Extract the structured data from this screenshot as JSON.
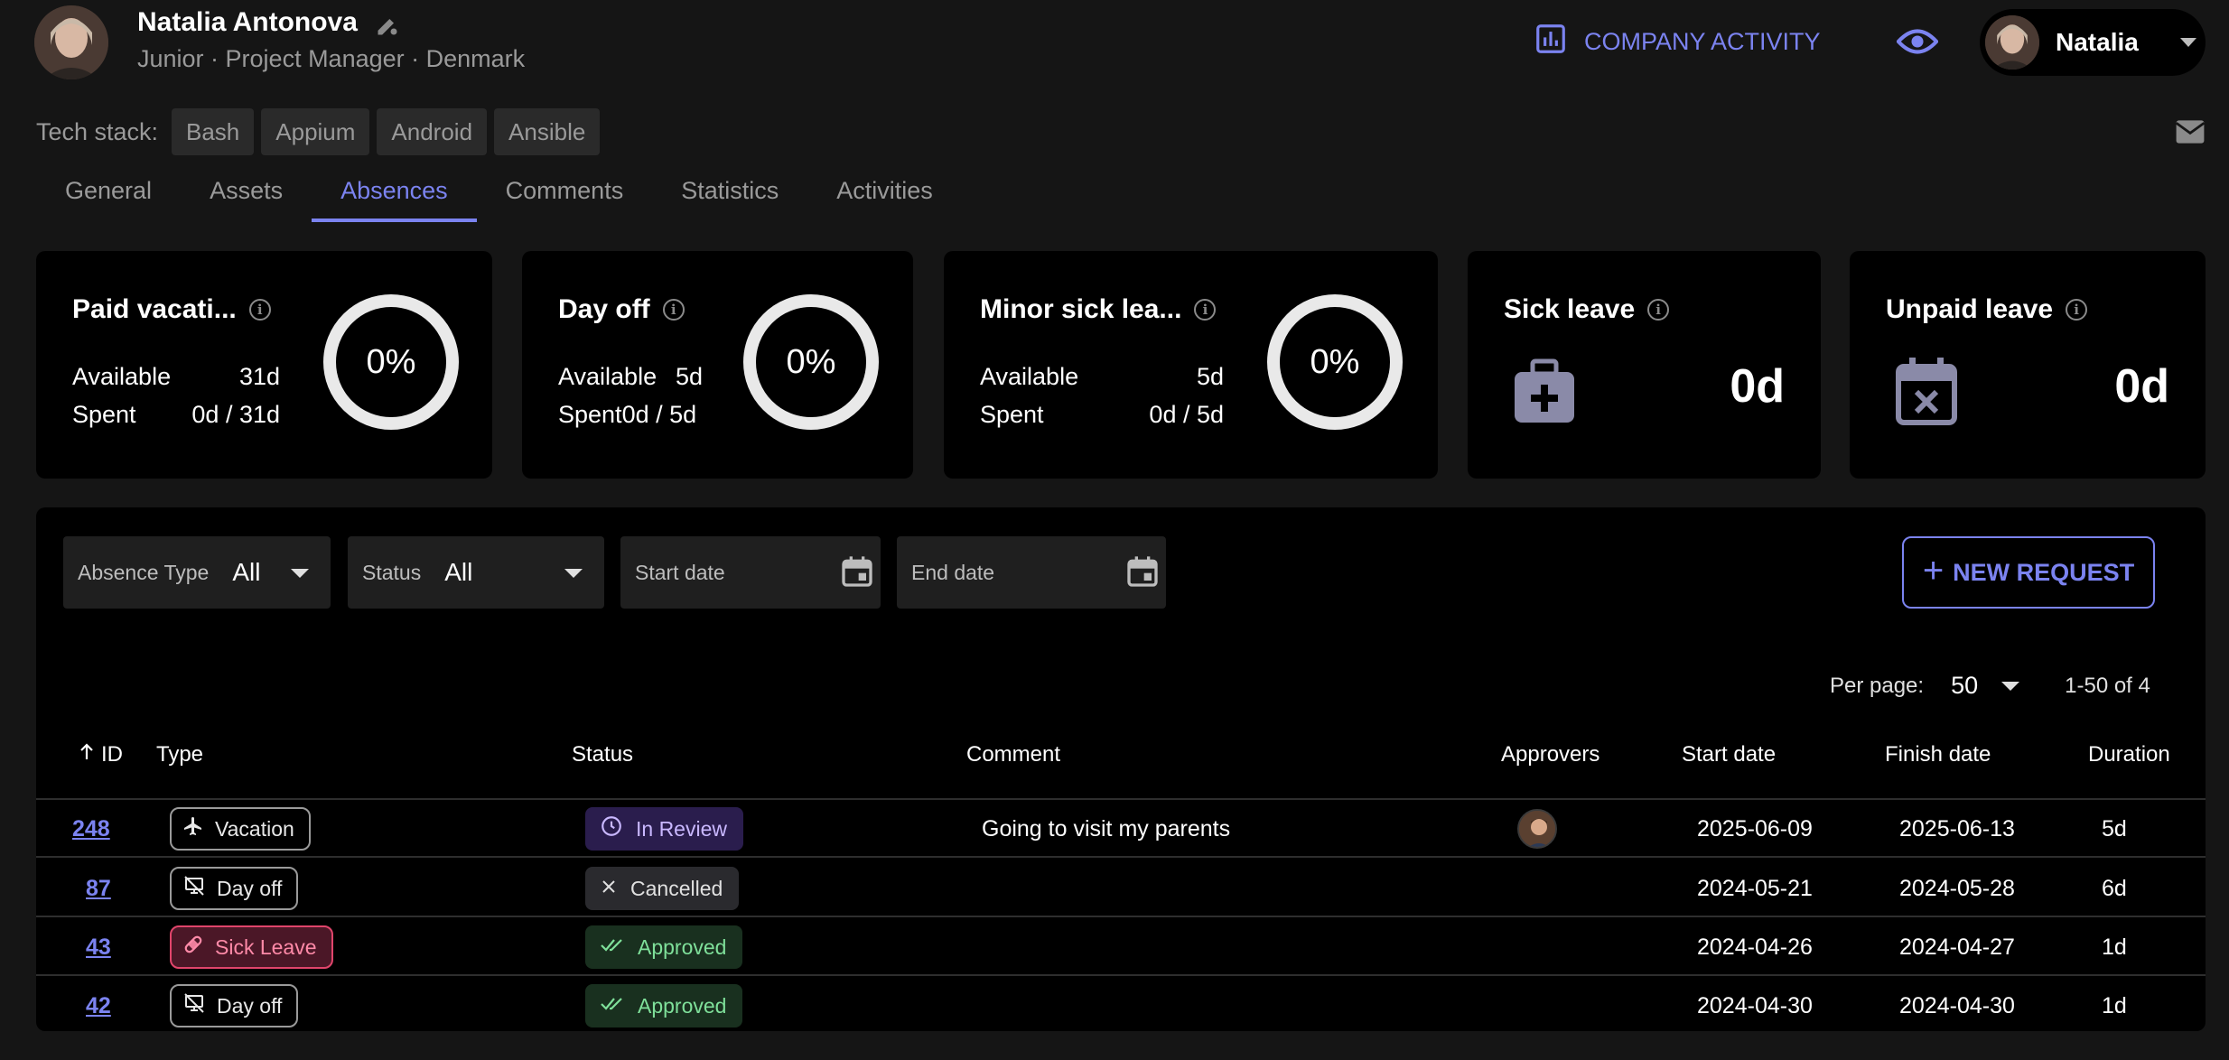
{
  "header": {
    "name": "Natalia Antonova",
    "subtitle": "Junior · Project Manager · Denmark",
    "company_activity": "COMPANY ACTIVITY",
    "user_name": "Natalia"
  },
  "tech_stack": {
    "label": "Tech stack:",
    "items": [
      "Bash",
      "Appium",
      "Android",
      "Ansible"
    ]
  },
  "tabs": [
    "General",
    "Assets",
    "Absences",
    "Comments",
    "Statistics",
    "Activities"
  ],
  "active_tab": "Absences",
  "cards": {
    "paid": {
      "title": "Paid vacati...",
      "available_label": "Available",
      "available": "31d",
      "spent_label": "Spent",
      "spent": "0d / 31d",
      "percent": "0%"
    },
    "dayoff": {
      "title": "Day off",
      "available_label": "Available",
      "available": "5d",
      "spent_label": "Spent",
      "spent": "0d / 5d",
      "percent": "0%"
    },
    "minor": {
      "title": "Minor sick lea...",
      "available_label": "Available",
      "available": "5d",
      "spent_label": "Spent",
      "spent": "0d / 5d",
      "percent": "0%"
    },
    "sick": {
      "title": "Sick leave",
      "value": "0d"
    },
    "unpaid": {
      "title": "Unpaid leave",
      "value": "0d"
    }
  },
  "filters": {
    "absence_type_label": "Absence Type",
    "absence_type_value": "All",
    "status_label": "Status",
    "status_value": "All",
    "start_date_placeholder": "Start date",
    "end_date_placeholder": "End date",
    "new_request": "NEW REQUEST"
  },
  "pagination": {
    "per_page_label": "Per page:",
    "per_page_value": "50",
    "range": "1-50 of 4"
  },
  "table": {
    "columns": {
      "id": "ID",
      "type": "Type",
      "status": "Status",
      "comment": "Comment",
      "approvers": "Approvers",
      "start": "Start date",
      "finish": "Finish date",
      "duration": "Duration"
    },
    "rows": [
      {
        "id": "248",
        "type": "Vacation",
        "status": "In Review",
        "comment": "Going to visit my parents",
        "start": "2025-06-09",
        "finish": "2025-06-13",
        "duration": "5d"
      },
      {
        "id": "87",
        "type": "Day off",
        "status": "Cancelled",
        "comment": "",
        "start": "2024-05-21",
        "finish": "2024-05-28",
        "duration": "6d"
      },
      {
        "id": "43",
        "type": "Sick Leave",
        "status": "Approved",
        "comment": "",
        "start": "2024-04-26",
        "finish": "2024-04-27",
        "duration": "1d"
      },
      {
        "id": "42",
        "type": "Day off",
        "status": "Approved",
        "comment": "",
        "start": "2024-04-30",
        "finish": "2024-04-30",
        "duration": "1d"
      }
    ]
  },
  "colors": {
    "accent": "#7b83f0",
    "background": "#151515",
    "card": "#000000",
    "review": "#2a1d4d",
    "approved": "#19301f",
    "sick": "#e0456b"
  },
  "icons": [
    "edit-icon",
    "chart-icon",
    "eye-icon",
    "chevron-down-icon",
    "mail-icon",
    "info-icon",
    "medical-bag-icon",
    "calendar-x-icon",
    "calendar-icon",
    "plus-icon",
    "arrow-up-icon",
    "airplane-icon",
    "monitor-off-icon",
    "pill-icon",
    "clock-icon",
    "close-icon",
    "double-check-icon"
  ]
}
